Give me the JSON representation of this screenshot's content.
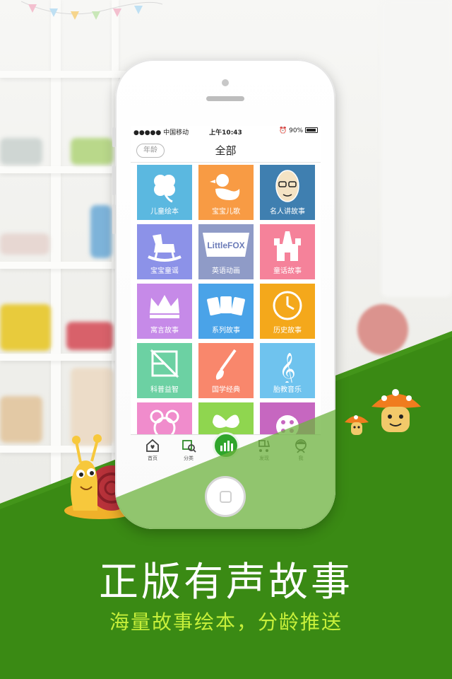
{
  "status_bar": {
    "carrier": "●●●●● 中国移动",
    "time": "上午10:43",
    "battery": "90%"
  },
  "nav": {
    "age_button": "年龄",
    "title": "全部"
  },
  "categories": [
    {
      "label": "儿童绘本",
      "color": "#5bb8e0",
      "icon": "clover-icon"
    },
    {
      "label": "宝宝儿歌",
      "color": "#f89b44",
      "icon": "duck-icon"
    },
    {
      "label": "名人讲故事",
      "color": "#3f7fb0",
      "icon": "face-icon"
    },
    {
      "label": "宝宝童谣",
      "color": "#8c92e8",
      "icon": "rocking-horse-icon"
    },
    {
      "label": "英语动画",
      "color": "#8f9bc7",
      "icon": "little-fox-logo-icon"
    },
    {
      "label": "童话故事",
      "color": "#f5829a",
      "icon": "castle-icon"
    },
    {
      "label": "寓言故事",
      "color": "#c68ae8",
      "icon": "crown-icon"
    },
    {
      "label": "系列故事",
      "color": "#4aa3e8",
      "icon": "cards-icon"
    },
    {
      "label": "历史故事",
      "color": "#f4a81b",
      "icon": "clock-icon"
    },
    {
      "label": "科普益智",
      "color": "#6cd1a3",
      "icon": "tangram-icon"
    },
    {
      "label": "国学经典",
      "color": "#f9876c",
      "icon": "brush-icon"
    },
    {
      "label": "胎教音乐",
      "color": "#6fc3ee",
      "icon": "treble-clef-icon"
    },
    {
      "label": "",
      "color": "#f08ccc",
      "icon": "mouse-icon"
    },
    {
      "label": "",
      "color": "#8fd64f",
      "icon": "butterfly-icon"
    },
    {
      "label": "",
      "color": "#c667c0",
      "icon": "film-reel-icon"
    }
  ],
  "tabs": [
    {
      "label": "首页",
      "icon": "home-icon"
    },
    {
      "label": "分类",
      "icon": "category-search-icon"
    },
    {
      "label": "",
      "icon": "player-bars-icon"
    },
    {
      "label": "发现",
      "icon": "stroller-icon"
    },
    {
      "label": "我",
      "icon": "kid-avatar-icon"
    }
  ],
  "slogan": {
    "title": "正版有声故事",
    "subtitle": "海量故事绘本，分龄推送"
  },
  "colors": {
    "brand_green": "#3a8a14",
    "accent_yellow": "#c7f03a",
    "tab_center": "#2fa52b"
  }
}
